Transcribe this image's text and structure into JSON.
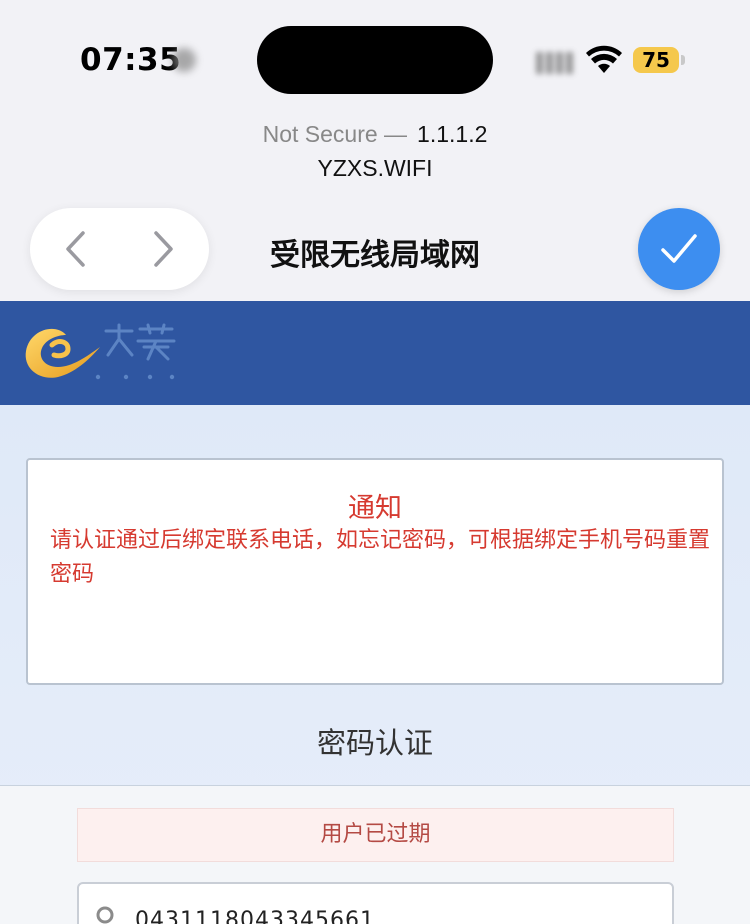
{
  "status": {
    "time": "07:35",
    "battery": "75"
  },
  "address": {
    "security": "Not Secure —",
    "host": "1.1.1.2",
    "ssid": "YZXS.WIFI"
  },
  "nav": {
    "title": "受限无线局域网"
  },
  "notice": {
    "title": "通知",
    "body": "请认证通过后绑定联系电话，如忘记密码，可根据绑定手机号码重置密码"
  },
  "auth": {
    "title": "密码认证",
    "status_message": "用户已过期",
    "phone_value": "0431118043345661"
  },
  "colors": {
    "header_band": "#2f56a1",
    "notice_red": "#d63a30",
    "accent_blue": "#3d8ef0",
    "battery_yellow": "#f5c84c"
  }
}
